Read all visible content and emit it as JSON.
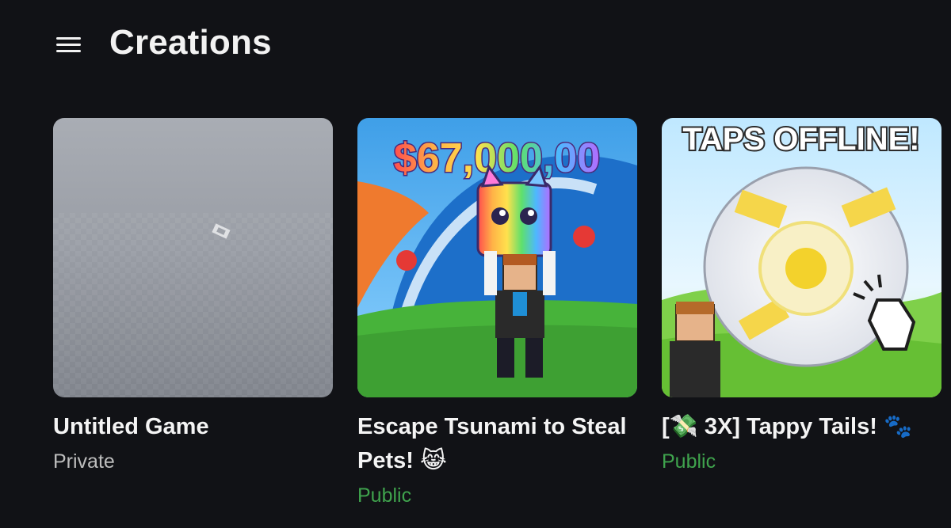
{
  "header": {
    "title": "Creations",
    "menu_icon": "hamburger-menu-icon"
  },
  "colors": {
    "background": "#111216",
    "public_status": "#3fa34d",
    "private_status": "#bdbdbd"
  },
  "cards": [
    {
      "title": "Untitled Game",
      "status": "Private",
      "thumbnail_icon": "baseplate-thumbnail"
    },
    {
      "title": "Escape Tsunami to Steal Pets! 😹",
      "status": "Public",
      "thumbnail_text": "$67,000,00",
      "thumbnail_icon": "tsunami-cat-thumbnail"
    },
    {
      "title": "[💸 3X] Tappy Tails! 🐾",
      "status": "Public",
      "thumbnail_text": "TAPS OFFLINE!",
      "thumbnail_icon": "tapping-egg-thumbnail"
    }
  ]
}
